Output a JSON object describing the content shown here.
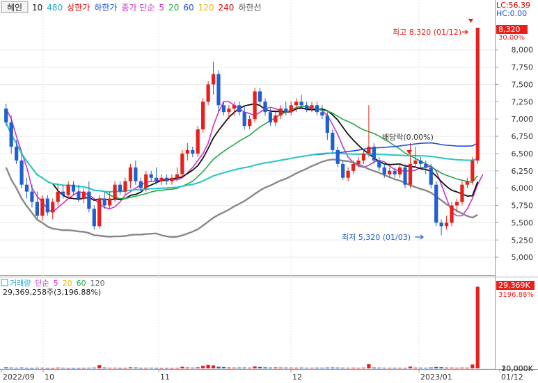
{
  "header": {
    "stock_name": "혜인",
    "ma_labels": [
      {
        "text": "10",
        "color": "#222222"
      },
      {
        "text": "480",
        "color": "#22aacc"
      },
      {
        "text": "상한가",
        "color": "#dd0000"
      },
      {
        "text": "하한가",
        "color": "#1f4fd8"
      },
      {
        "text": "종가 단순",
        "color": "#cc33cc"
      },
      {
        "text": "5",
        "color": "#cc33cc"
      },
      {
        "text": "20",
        "color": "#22aa44"
      },
      {
        "text": "60",
        "color": "#1f4fd8"
      },
      {
        "text": "120",
        "color": "#f0b400"
      },
      {
        "text": "240",
        "color": "#dd0000"
      },
      {
        "text": "하한선",
        "color": "#555555"
      }
    ],
    "lc": "LC:56.39",
    "hc": "HC:0.00"
  },
  "price_scale": {
    "current": "8,320",
    "current_pct": "30.00%",
    "ticks": [
      "8,000",
      "7,750",
      "7,500",
      "7,250",
      "7,000",
      "6,750",
      "6,500",
      "6,250",
      "6,000",
      "5,750",
      "5,500",
      "5,250",
      "5,000"
    ]
  },
  "annotations": {
    "high": "최고 8,320 (01/12)",
    "low": "최저 5,320 (01/03)",
    "dividend": "배당락(0.00%)"
  },
  "volume_panel": {
    "legend": [
      {
        "text": "거래량",
        "color": "#22aacc"
      },
      {
        "text": "단순",
        "color": "#cc33cc"
      },
      {
        "text": "5",
        "color": "#cc33cc"
      },
      {
        "text": "20",
        "color": "#f0b400"
      },
      {
        "text": "60",
        "color": "#22aa44"
      },
      {
        "text": "120",
        "color": "#666666"
      }
    ],
    "stat": "29,369,258주(3,196.88%)",
    "current": "29,369K",
    "current_pct": "3196.88%",
    "ticks": [
      "20,000K",
      "10,000K"
    ]
  },
  "x_axis": {
    "labels": [
      "2022/09",
      "10",
      "11",
      "12",
      "2023/01",
      "01/12"
    ]
  },
  "colors": {
    "up": "#e8201c",
    "down": "#1f5fd0"
  },
  "chart_data": {
    "type": "candlestick",
    "price_ylim": [
      4750,
      8500
    ],
    "volume_ylim": [
      0,
      30000
    ],
    "volume_unit": "K",
    "candles": [
      [
        7150,
        7220,
        6900,
        6950
      ],
      [
        6950,
        7050,
        6500,
        6600
      ],
      [
        6600,
        6700,
        6350,
        6400
      ],
      [
        6400,
        6500,
        6000,
        6050
      ],
      [
        6050,
        6150,
        5850,
        5950
      ],
      [
        5950,
        6050,
        5720,
        5800
      ],
      [
        5800,
        5950,
        5550,
        5600
      ],
      [
        5600,
        5900,
        5530,
        5850
      ],
      [
        5850,
        5900,
        5600,
        5650
      ],
      [
        5650,
        5850,
        5550,
        5800
      ],
      [
        5800,
        6050,
        5750,
        5950
      ],
      [
        5950,
        6050,
        5850,
        5900
      ],
      [
        5900,
        6100,
        5850,
        6050
      ],
      [
        6050,
        6100,
        5900,
        5950
      ],
      [
        5950,
        6050,
        5800,
        5850
      ],
      [
        5850,
        6000,
        5780,
        5950
      ],
      [
        5950,
        6100,
        5650,
        5700
      ],
      [
        5700,
        5750,
        5400,
        5450
      ],
      [
        5450,
        5900,
        5420,
        5850
      ],
      [
        5850,
        5950,
        5700,
        5750
      ],
      [
        5750,
        5950,
        5700,
        5850
      ],
      [
        5850,
        6100,
        5800,
        6050
      ],
      [
        6050,
        6100,
        5900,
        5950
      ],
      [
        5950,
        6150,
        5900,
        6100
      ],
      [
        6100,
        6350,
        6000,
        6300
      ],
      [
        6300,
        6400,
        6050,
        6100
      ],
      [
        6100,
        6150,
        5950,
        6000
      ],
      [
        6000,
        6250,
        5950,
        6200
      ],
      [
        6200,
        6250,
        6100,
        6150
      ],
      [
        6150,
        6300,
        6050,
        6100
      ],
      [
        6100,
        6200,
        6050,
        6150
      ],
      [
        6150,
        6200,
        6050,
        6100
      ],
      [
        6100,
        6200,
        6050,
        6150
      ],
      [
        6150,
        6300,
        6100,
        6200
      ],
      [
        6200,
        6550,
        6150,
        6500
      ],
      [
        6500,
        6650,
        6400,
        6550
      ],
      [
        6550,
        6600,
        6450,
        6500
      ],
      [
        6500,
        6900,
        6450,
        6850
      ],
      [
        6850,
        7300,
        6800,
        7250
      ],
      [
        7250,
        7550,
        7200,
        7500
      ],
      [
        7500,
        7830,
        7350,
        7650
      ],
      [
        7650,
        7700,
        7100,
        7200
      ],
      [
        7200,
        7250,
        7050,
        7100
      ],
      [
        7100,
        7200,
        7000,
        7150
      ],
      [
        7150,
        7250,
        7050,
        7200
      ],
      [
        7200,
        7250,
        7050,
        7100
      ],
      [
        7100,
        7200,
        6850,
        6900
      ],
      [
        6900,
        7050,
        6850,
        7000
      ],
      [
        7000,
        7450,
        6950,
        7400
      ],
      [
        7400,
        7450,
        7200,
        7250
      ],
      [
        7250,
        7300,
        7050,
        7100
      ],
      [
        7100,
        7150,
        6900,
        6950
      ],
      [
        6950,
        7100,
        6900,
        7050
      ],
      [
        7050,
        7200,
        7000,
        7150
      ],
      [
        7150,
        7250,
        7050,
        7100
      ],
      [
        7100,
        7250,
        7050,
        7200
      ],
      [
        7200,
        7300,
        7100,
        7250
      ],
      [
        7250,
        7350,
        7150,
        7200
      ],
      [
        7200,
        7250,
        7100,
        7150
      ],
      [
        7150,
        7250,
        7100,
        7200
      ],
      [
        7200,
        7250,
        7050,
        7100
      ],
      [
        7100,
        7200,
        7000,
        7050
      ],
      [
        7050,
        7100,
        6700,
        6800
      ],
      [
        6800,
        6850,
        6500,
        6550
      ],
      [
        6550,
        6600,
        6300,
        6350
      ],
      [
        6350,
        6400,
        6120,
        6150
      ],
      [
        6150,
        6300,
        6100,
        6250
      ],
      [
        6250,
        6400,
        6200,
        6350
      ],
      [
        6350,
        6450,
        6300,
        6400
      ],
      [
        6400,
        6550,
        6350,
        6500
      ],
      [
        6500,
        7200,
        6450,
        6600
      ],
      [
        6600,
        6650,
        6350,
        6400
      ],
      [
        6400,
        6450,
        6250,
        6300
      ],
      [
        6300,
        6350,
        6150,
        6200
      ],
      [
        6200,
        6300,
        6150,
        6250
      ],
      [
        6250,
        6300,
        6150,
        6200
      ],
      [
        6200,
        6350,
        6150,
        6300
      ],
      [
        6300,
        6350,
        6000,
        6050
      ],
      [
        6050,
        6650,
        6000,
        6350
      ],
      [
        6350,
        6600,
        6300,
        6400
      ],
      [
        6400,
        6450,
        6300,
        6350
      ],
      [
        6350,
        6400,
        6200,
        6300
      ],
      [
        6300,
        6350,
        6000,
        6050
      ],
      [
        6050,
        6100,
        5450,
        5500
      ],
      [
        5500,
        5550,
        5320,
        5450
      ],
      [
        5450,
        5600,
        5400,
        5500
      ],
      [
        5500,
        5800,
        5450,
        5750
      ],
      [
        5750,
        5850,
        5650,
        5800
      ],
      [
        5800,
        6100,
        5750,
        6050
      ],
      [
        6050,
        6150,
        6000,
        6100
      ],
      [
        6100,
        6450,
        6050,
        6400
      ],
      [
        6400,
        8320,
        6350,
        8320
      ]
    ],
    "volumes": [
      400,
      300,
      250,
      320,
      200,
      180,
      260,
      240,
      150,
      130,
      300,
      230,
      160,
      170,
      140,
      190,
      260,
      310,
      1200,
      320,
      240,
      260,
      200,
      210,
      400,
      330,
      210,
      230,
      260,
      200,
      180,
      190,
      170,
      240,
      600,
      340,
      290,
      400,
      900,
      1300,
      1100,
      600,
      500,
      350,
      300,
      320,
      330,
      280,
      700,
      540,
      400,
      320,
      380,
      330,
      310,
      290,
      270,
      300,
      260,
      250,
      280,
      270,
      330,
      350,
      300,
      280,
      260,
      270,
      240,
      300,
      1500,
      330,
      290,
      260,
      240,
      230,
      240,
      230,
      650,
      300,
      270,
      250,
      350,
      540,
      460,
      310,
      290,
      260,
      300,
      280,
      1400,
      29369
    ],
    "ma5": [
      7150,
      7000,
      6750,
      6520,
      6300,
      6000,
      5880,
      5800,
      5700,
      5650,
      5720,
      5780,
      5850,
      5900,
      5950,
      5930,
      5900,
      5850,
      5770,
      5720,
      5700,
      5730,
      5800,
      5900,
      5950,
      6000,
      6050,
      6080,
      6100,
      6100,
      6120,
      6130,
      6120,
      6120,
      6150,
      6220,
      6300,
      6400,
      6500,
      6650,
      6900,
      7100,
      7250,
      7250,
      7200,
      7150,
      7100,
      7080,
      7050,
      7100,
      7150,
      7170,
      7150,
      7120,
      7100,
      7100,
      7150,
      7150,
      7150,
      7160,
      7150,
      7120,
      7050,
      6920,
      6780,
      6600,
      6450,
      6370,
      6320,
      6300,
      6330,
      6380,
      6400,
      6380,
      6320,
      6270,
      6250,
      6250,
      6250,
      6260,
      6300,
      6300,
      6320,
      6250,
      6050,
      5850,
      5650,
      5600,
      5600,
      5700,
      5850,
      6050,
      6200
    ]
  }
}
